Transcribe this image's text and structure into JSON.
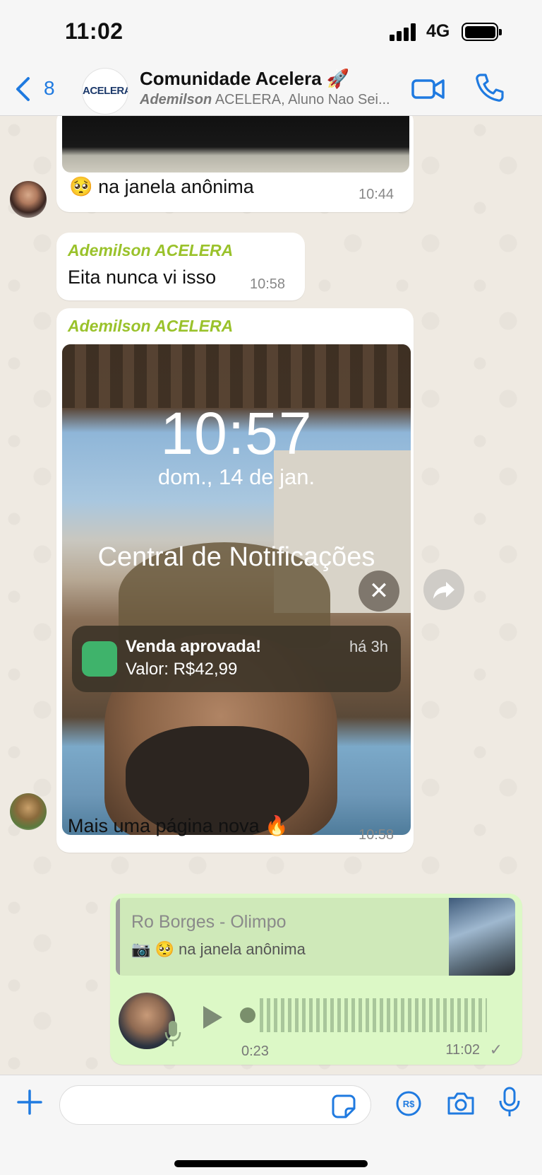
{
  "status_bar": {
    "time": "11:02",
    "network": "4G"
  },
  "header": {
    "back_count": "8",
    "group_logo": "ACELERA",
    "title": "Comunidade Acelera 🚀",
    "subtitle_bold": "Ademilson",
    "subtitle_rest": " ACELERA, Aluno Nao Sei..."
  },
  "messages": [
    {
      "text": "🥺 na janela anônima",
      "time": "10:44"
    },
    {
      "sender": "Ademilson ACELERA",
      "text": "Eita nunca vi isso",
      "time": "10:58"
    },
    {
      "sender": "Ademilson ACELERA",
      "caption": "Mais uma página nova 🔥",
      "time": "10:58",
      "lockscreen": {
        "time": "10:57",
        "date": "dom., 14 de jan.",
        "center_title": "Central de Notificações",
        "notification": {
          "title": "Venda aprovada!",
          "body": "Valor: R$42,99",
          "age": "há 3h"
        }
      }
    }
  ],
  "outgoing": {
    "quote_name": "Ro Borges - Olimpo",
    "quote_text": "🥺 na janela anônima",
    "voice_duration": "0:23",
    "time": "11:02",
    "status": "✓"
  },
  "colors": {
    "accent": "#1f7ae0",
    "sender": "#9ac22b",
    "outgoing_bubble": "#dcf8c6",
    "chat_bg": "#efeae2"
  },
  "icons": [
    "back-chevron-icon",
    "video-call-icon",
    "phone-icon",
    "forward-icon",
    "play-icon",
    "mic-icon",
    "plus-icon",
    "sticker-icon",
    "payment-icon",
    "camera-icon"
  ]
}
